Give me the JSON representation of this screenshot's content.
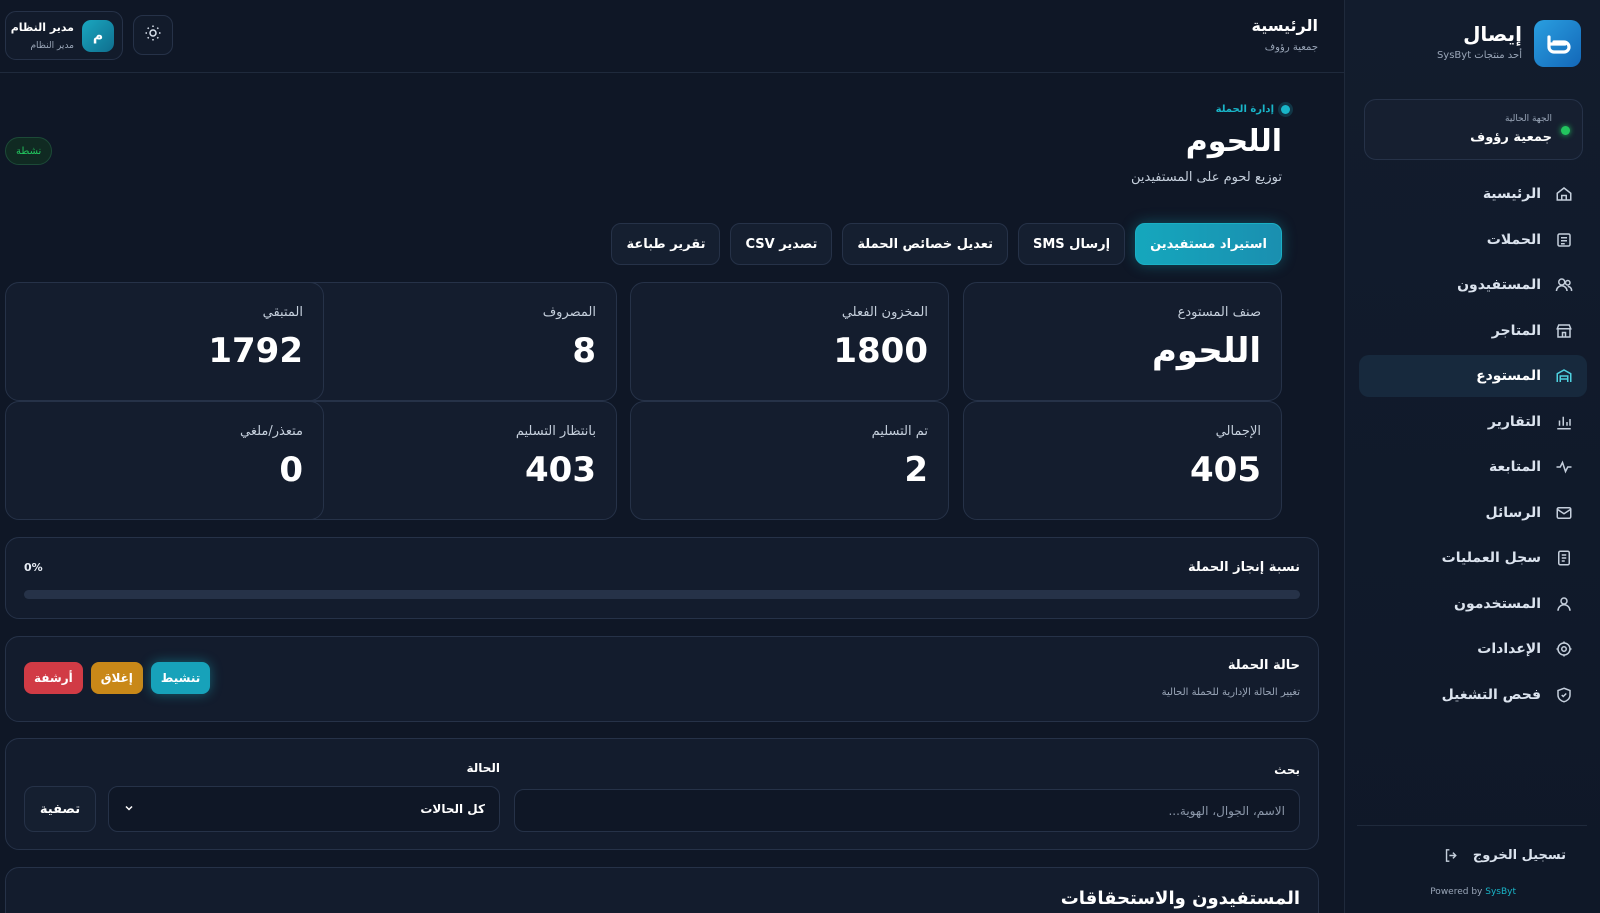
{
  "brand": {
    "name": "إيصال",
    "subtitle": "أحد منتجات SysByt"
  },
  "entity": {
    "label": "الجهة الحالية",
    "value": "جمعية رؤوف"
  },
  "nav": [
    {
      "label": "الرئيسية",
      "icon": "home-icon"
    },
    {
      "label": "الحملات",
      "icon": "campaigns-icon"
    },
    {
      "label": "المستفيدون",
      "icon": "users-icon"
    },
    {
      "label": "المتاجر",
      "icon": "store-icon"
    },
    {
      "label": "المستودع",
      "icon": "warehouse-icon",
      "active": true
    },
    {
      "label": "التقارير",
      "icon": "bar-chart-icon"
    },
    {
      "label": "المتابعة",
      "icon": "activity-icon"
    },
    {
      "label": "الرسائل",
      "icon": "message-icon"
    },
    {
      "label": "سجل العمليات",
      "icon": "log-icon"
    },
    {
      "label": "المستخدمون",
      "icon": "user-icon"
    },
    {
      "label": "الإعدادات",
      "icon": "gear-icon"
    },
    {
      "label": "فحص التشغيل",
      "icon": "shield-icon"
    }
  ],
  "logout": "تسجيل الخروج",
  "powered": {
    "prefix": "Powered by ",
    "brand": "SysByt"
  },
  "topbar": {
    "title": "الرئيسية",
    "subtitle": "جمعية رؤوف"
  },
  "user": {
    "initial": "م",
    "name": "مدير النظام",
    "role": "مدير النظام"
  },
  "page": {
    "breadcrumb": "إدارة الحملة",
    "title": "اللحوم",
    "subtitle": "توزيع لحوم على المستفيدين",
    "status_badge": "نشطة"
  },
  "actions": {
    "import": "استيراد مستفيدين",
    "sms": "إرسال SMS",
    "edit": "تعديل خصائص الحملة",
    "csv": "تصدير CSV",
    "print": "تقرير طباعة"
  },
  "stats": {
    "category": {
      "label": "صنف المستودع",
      "value": "اللحوم"
    },
    "stock": {
      "label": "المخزون الفعلي",
      "value": "1800"
    },
    "spent": {
      "label": "المصروف",
      "value": "8"
    },
    "remaining": {
      "label": "المتبقي",
      "value": "1792"
    },
    "total": {
      "label": "الإجمالي",
      "value": "405"
    },
    "delivered": {
      "label": "تم التسليم",
      "value": "2"
    },
    "pending": {
      "label": "بانتظار التسليم",
      "value": "403"
    },
    "failed": {
      "label": "متعذر/ملغي",
      "value": "0"
    }
  },
  "progress": {
    "title": "نسبة إنجاز الحملة",
    "percent_text": "0%",
    "percent": 0
  },
  "status_panel": {
    "title": "حالة الحملة",
    "subtitle": "تغيير الحالة الإدارية للحملة الحالية",
    "activate": "تنشيط",
    "close": "إغلاق",
    "archive": "أرشفة"
  },
  "filters": {
    "search_label": "بحث",
    "search_placeholder": "الاسم، الجوال، الهوية...",
    "status_label": "الحالة",
    "status_value": "كل الحالات",
    "filter_button": "تصفية"
  },
  "beneficiaries": {
    "title": "المستفيدون والاستحقاقات"
  },
  "colors": {
    "accent": "#19b5c8",
    "background": "#0f1726",
    "success": "#22c55e",
    "danger": "#d13b45",
    "warning": "#c98818"
  }
}
